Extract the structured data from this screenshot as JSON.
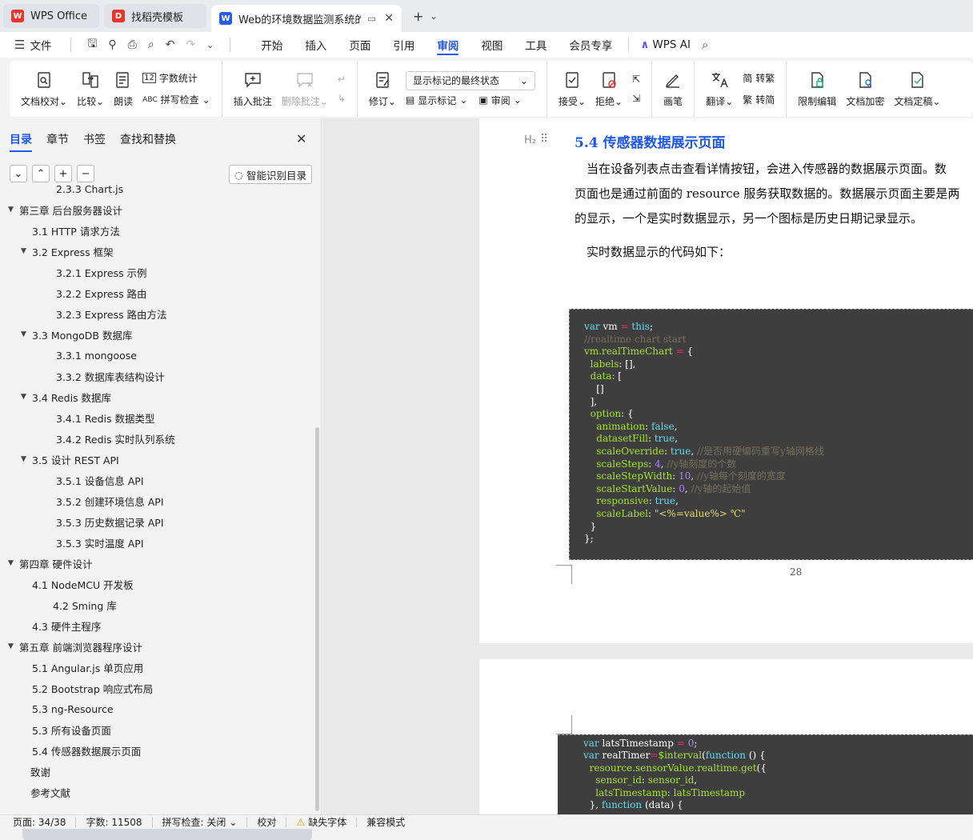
{
  "tabs": [
    {
      "label": "WPS Office",
      "icon": "wps-logo-icon",
      "color": "#e8362c"
    },
    {
      "label": "找稻壳模板",
      "icon": "docer-icon",
      "color": "#e8362c"
    },
    {
      "label": "Web的环境数据监测系统的设",
      "icon": "word-doc-icon",
      "color": "#2b5ce6",
      "active": true
    }
  ],
  "menu": {
    "file": "文件",
    "items": [
      "开始",
      "插入",
      "页面",
      "引用",
      "审阅",
      "视图",
      "工具",
      "会员专享"
    ],
    "active": "审阅",
    "wps_ai": "WPS AI"
  },
  "ribbon": {
    "proofread": "文档校对",
    "compare": "比较",
    "read_aloud": "朗读",
    "word_count": "字数统计",
    "spell_check": "拼写检查",
    "insert_comment": "插入批注",
    "delete_comment": "删除批注",
    "revise": "修订",
    "markup_select": "显示标记的最终状态",
    "show_markup": "显示标记",
    "review": "审阅",
    "accept": "接受",
    "reject": "拒绝",
    "pen": "画笔",
    "translate": "翻译",
    "to_traditional": "转繁",
    "to_simplified": "转简",
    "restrict_edit": "限制编辑",
    "encrypt": "文档加密",
    "finalize": "文档定稿"
  },
  "sidebar": {
    "tabs": [
      "目录",
      "章节",
      "书签",
      "查找和替换"
    ],
    "smart_toc": "智能识别目录",
    "toc": [
      {
        "label": "2.3.3 Chart.js",
        "level": 3
      },
      {
        "label": "第三章 后台服务器设计",
        "level": 1,
        "expanded": true
      },
      {
        "label": "3.1 HTTP 请求方法",
        "level": 2
      },
      {
        "label": "3.2 Express 框架",
        "level": 2,
        "expanded": true
      },
      {
        "label": "3.2.1 Express 示例",
        "level": 3
      },
      {
        "label": "3.2.2 Express 路由",
        "level": 3
      },
      {
        "label": "3.2.3 Express 路由方法",
        "level": 3
      },
      {
        "label": "3.3 MongoDB 数据库",
        "level": 2,
        "expanded": true
      },
      {
        "label": "3.3.1 mongoose",
        "level": 3
      },
      {
        "label": "3.3.2 数据库表结构设计",
        "level": 3
      },
      {
        "label": "3.4 Redis 数据库",
        "level": 2,
        "expanded": true
      },
      {
        "label": "3.4.1 Redis 数据类型",
        "level": 3
      },
      {
        "label": "3.4.2 Redis 实时队列系统",
        "level": 3
      },
      {
        "label": "3.5 设计 REST API",
        "level": 2,
        "expanded": true
      },
      {
        "label": "3.5.1 设备信息 API",
        "level": 3
      },
      {
        "label": "3.5.2 创建环境信息 API",
        "level": 3
      },
      {
        "label": "3.5.3 历史数据记录 API",
        "level": 3
      },
      {
        "label": "3.5.3 实时温度 API",
        "level": 3
      },
      {
        "label": "第四章 硬件设计",
        "level": 1,
        "expanded": true
      },
      {
        "label": "4.1 NodeMCU 开发板",
        "level": 2
      },
      {
        "label": "4.2 Sming 库",
        "level": 2.5
      },
      {
        "label": "4.3 硬件主程序",
        "level": 2
      },
      {
        "label": "第五章 前端浏览器程序设计",
        "level": 1,
        "expanded": true
      },
      {
        "label": "5.1 Angular.js 单页应用",
        "level": 2
      },
      {
        "label": "5.2 Bootstrap 响应式布局",
        "level": 2
      },
      {
        "label": "5.3 ng-Resource",
        "level": 2
      },
      {
        "label": "5.3 所有设备页面",
        "level": 2
      },
      {
        "label": "5.4 传感器数据展示页面",
        "level": 2,
        "selected": true
      },
      {
        "label": "致谢",
        "level": 1
      },
      {
        "label": "参考文献",
        "level": 1
      }
    ]
  },
  "document": {
    "heading_marker": "H₂",
    "heading": "5.4 传感器数据展示页面",
    "para_lines": [
      "当在设备列表点击查看详情按钮，会进入传感器的数据展示页面。数",
      "页面也是通过前面的 resource 服务获取数据的。数据展示页面主要是两",
      "的显示，一个是实时数据显示，另一个图标是历史日期记录显示。"
    ],
    "para2": "实时数据显示的代码如下：",
    "page_number": "28"
  },
  "status": {
    "page": "页面: 34/38",
    "words": "字数: 11508",
    "spell": "拼写检查: 关闭",
    "proof": "校对",
    "missing_font": "缺失字体",
    "compat": "兼容模式"
  }
}
